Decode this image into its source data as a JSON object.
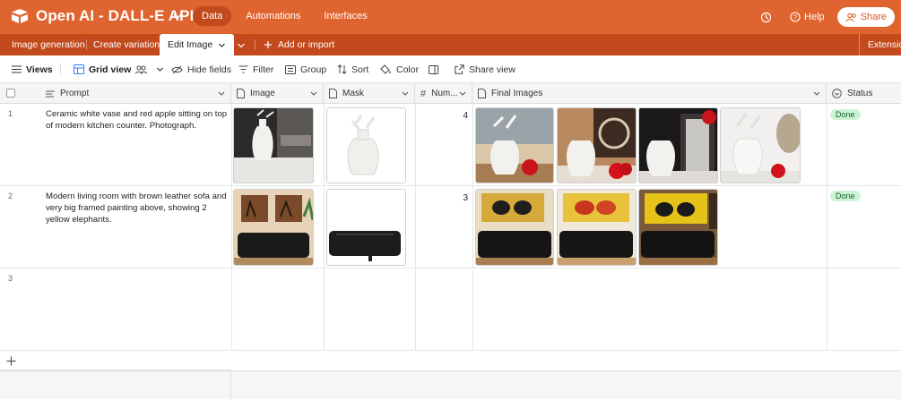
{
  "header": {
    "app_title": "Open AI - DALL-E API",
    "nav": [
      "Data",
      "Automations",
      "Interfaces"
    ],
    "help_label": "Help",
    "share_label": "Share"
  },
  "tabs": {
    "items": [
      "Image generation",
      "Create variation",
      "Edit Image"
    ],
    "add_label": "Add or import",
    "extension_label": "Extension"
  },
  "toolbar": {
    "views": "Views",
    "grid_view": "Grid view",
    "hide_fields": "Hide fields",
    "filter": "Filter",
    "group": "Group",
    "sort": "Sort",
    "color": "Color",
    "share_view": "Share view"
  },
  "columns": {
    "prompt": "Prompt",
    "image": "Image",
    "mask": "Mask",
    "number": "Num...",
    "final_images": "Final Images",
    "status": "Status"
  },
  "rows": [
    {
      "num": "1",
      "prompt": "Ceramic white vase and red apple sitting on top of modern kitchen counter. Photograph.",
      "count": "4",
      "status": "Done"
    },
    {
      "num": "2",
      "prompt": "Modern living room with brown leather sofa and very big framed painting above, showing 2 yellow elephants.",
      "count": "3",
      "status": "Done"
    },
    {
      "num": "3",
      "prompt": "",
      "count": "",
      "status": ""
    }
  ],
  "colors": {
    "brand": "#e0642f",
    "brand_dark": "#c24a1c",
    "done_badge_bg": "#cdf3d6"
  },
  "icons": [
    "airtable-logo-icon",
    "chevron-down-icon",
    "history-icon",
    "help-icon",
    "share-people-icon",
    "plus-icon",
    "hamburger-icon",
    "grid-view-icon",
    "people-icon",
    "hide-fields-icon",
    "filter-icon",
    "group-icon",
    "sort-icon",
    "color-icon",
    "row-height-icon",
    "share-view-icon",
    "checkbox-icon",
    "text-field-icon",
    "attachment-icon",
    "number-icon",
    "status-icon"
  ]
}
